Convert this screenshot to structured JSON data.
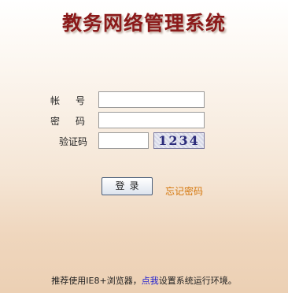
{
  "title": "教务网络管理系统",
  "form": {
    "account_label": "帐　号",
    "password_label": "密　码",
    "captcha_label": "验证码",
    "account_value": "",
    "password_value": "",
    "captcha_value": "",
    "captcha_image_text": "1234"
  },
  "actions": {
    "login_label": "登录",
    "forgot_label": "忘记密码"
  },
  "footer": {
    "prefix": "推荐使用IE8+浏览器，",
    "link": "点我",
    "suffix": "设置系统运行环境。"
  }
}
